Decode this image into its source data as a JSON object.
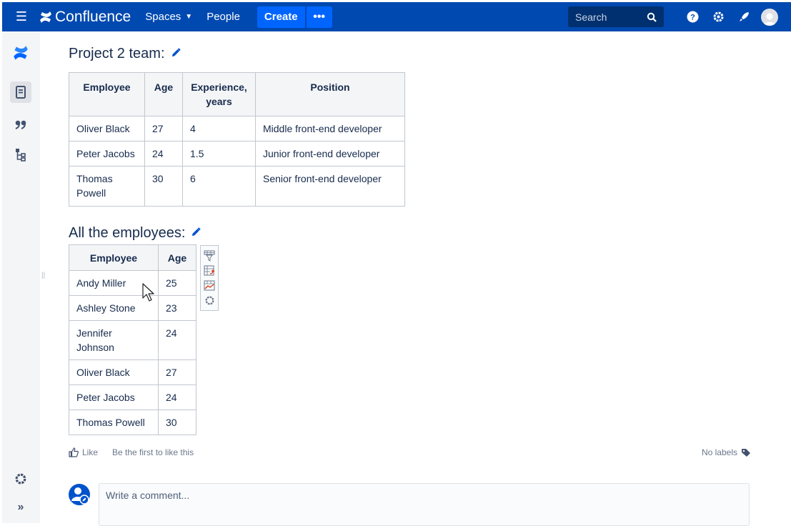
{
  "nav": {
    "app_name": "Confluence",
    "spaces": "Spaces",
    "people": "People",
    "create": "Create",
    "more": "•••",
    "search_placeholder": "Search"
  },
  "section1": {
    "title": "Project 2 team:",
    "headers": [
      "Employee",
      "Age",
      "Experience, years",
      "Position"
    ],
    "rows": [
      [
        "Oliver Black",
        "27",
        "4",
        "Middle front-end developer"
      ],
      [
        "Peter Jacobs",
        "24",
        "1.5",
        "Junior front-end developer"
      ],
      [
        "Thomas Powell",
        "30",
        "6",
        "Senior front-end developer"
      ]
    ]
  },
  "section2": {
    "title": "All the employees:",
    "headers": [
      "Employee",
      "Age"
    ],
    "rows": [
      [
        "Andy Miller",
        "25"
      ],
      [
        "Ashley Stone",
        "23"
      ],
      [
        "Jennifer Johnson",
        "24"
      ],
      [
        "Oliver Black",
        "27"
      ],
      [
        "Peter Jacobs",
        "24"
      ],
      [
        "Thomas Powell",
        "30"
      ]
    ]
  },
  "footer": {
    "like": "Like",
    "first_like": "Be the first to like this",
    "no_labels": "No labels"
  },
  "comment": {
    "placeholder": "Write a comment..."
  },
  "colors": {
    "nav_bg": "#0049b0",
    "create_bg": "#0065ff",
    "sidebar_bg": "#f4f5f7",
    "header_cell_bg": "#f4f5f7",
    "border": "#c1c7d0"
  }
}
